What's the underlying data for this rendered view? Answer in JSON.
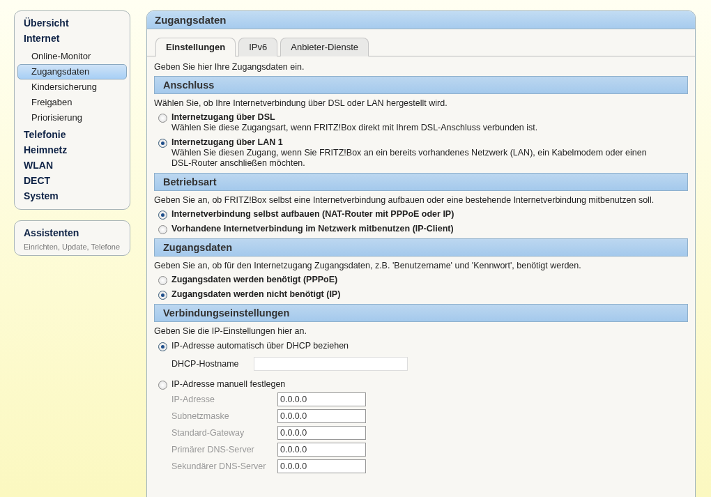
{
  "sidebar": {
    "items": [
      {
        "label": "Übersicht",
        "selected": false
      },
      {
        "label": "Internet",
        "selected": false,
        "children": [
          {
            "label": "Online-Monitor",
            "selected": false
          },
          {
            "label": "Zugangsdaten",
            "selected": true
          },
          {
            "label": "Kindersicherung",
            "selected": false
          },
          {
            "label": "Freigaben",
            "selected": false
          },
          {
            "label": "Priorisierung",
            "selected": false
          }
        ]
      },
      {
        "label": "Telefonie",
        "selected": false
      },
      {
        "label": "Heimnetz",
        "selected": false
      },
      {
        "label": "WLAN",
        "selected": false
      },
      {
        "label": "DECT",
        "selected": false
      },
      {
        "label": "System",
        "selected": false
      }
    ]
  },
  "assistant": {
    "title": "Assistenten",
    "subtitle": "Einrichten, Update, Telefone"
  },
  "panel": {
    "title": "Zugangsdaten",
    "tabs": [
      {
        "label": "Einstellungen",
        "selected": true
      },
      {
        "label": "IPv6",
        "selected": false
      },
      {
        "label": "Anbieter-Dienste",
        "selected": false
      }
    ],
    "intro": "Geben Sie hier Ihre Zugangsdaten ein.",
    "sections": [
      {
        "title": "Anschluss",
        "description": "Wählen Sie, ob Ihre Internetverbindung über DSL oder LAN hergestellt wird.",
        "options": [
          {
            "kind": "choice",
            "label": "Internetzugang über DSL",
            "selected": false,
            "description": "Wählen Sie diese Zugangsart, wenn FRITZ!Box direkt mit Ihrem DSL-Anschluss verbunden ist."
          },
          {
            "kind": "choice",
            "label": "Internetzugang über LAN 1",
            "selected": true,
            "description": "Wählen Sie diesen Zugang, wenn Sie FRITZ!Box an ein bereits vorhandenes Netzwerk (LAN), ein Kabelmodem oder einen DSL-Router anschließen möchten."
          }
        ]
      },
      {
        "title": "Betriebsart",
        "description": "Geben Sie an, ob FRITZ!Box selbst eine Internetverbindung aufbauen oder eine bestehende Internetverbindung mitbenutzen soll.",
        "options": [
          {
            "kind": "choice",
            "label": "Internetverbindung selbst aufbauen (NAT-Router mit PPPoE oder IP)",
            "selected": true
          },
          {
            "kind": "choice",
            "label": "Vorhandene Internetverbindung im Netzwerk mitbenutzen (IP-Client)",
            "selected": false
          }
        ]
      },
      {
        "title": "Zugangsdaten",
        "description": "Geben Sie an, ob für den Internetzugang Zugangsdaten, z.B. 'Benutzername' und 'Kennwort', benötigt werden.",
        "options": [
          {
            "kind": "choice",
            "label": "Zugangsdaten werden benötigt (PPPoE)",
            "selected": false
          },
          {
            "kind": "choice",
            "label": "Zugangsdaten werden nicht benötigt (IP)",
            "selected": true
          }
        ]
      },
      {
        "title": "Verbindungseinstellungen",
        "description": "Geben Sie die IP-Einstellungen hier an.",
        "options": [
          {
            "kind": "setting",
            "label": "IP-Adresse automatisch über DHCP beziehen",
            "selected": true,
            "fields": [
              {
                "kind": "hostname",
                "label": "DHCP-Hostname",
                "disabled": false
              }
            ]
          },
          {
            "kind": "setting",
            "label": "IP-Adresse manuell festlegen",
            "selected": false,
            "fields": [
              {
                "kind": "address",
                "label": "IP-Adresse",
                "value": "0.0.0.0",
                "disabled": true
              },
              {
                "kind": "address",
                "label": "Subnetzmaske",
                "value": "0.0.0.0",
                "disabled": true
              },
              {
                "kind": "address",
                "label": "Standard-Gateway",
                "value": "0.0.0.0",
                "disabled": true
              },
              {
                "kind": "address",
                "label": "Primärer DNS-Server",
                "value": "0.0.0.0",
                "disabled": true
              },
              {
                "kind": "address",
                "label": "Sekundärer DNS-Server",
                "value": "0.0.0.0",
                "disabled": true
              }
            ]
          }
        ]
      }
    ]
  }
}
